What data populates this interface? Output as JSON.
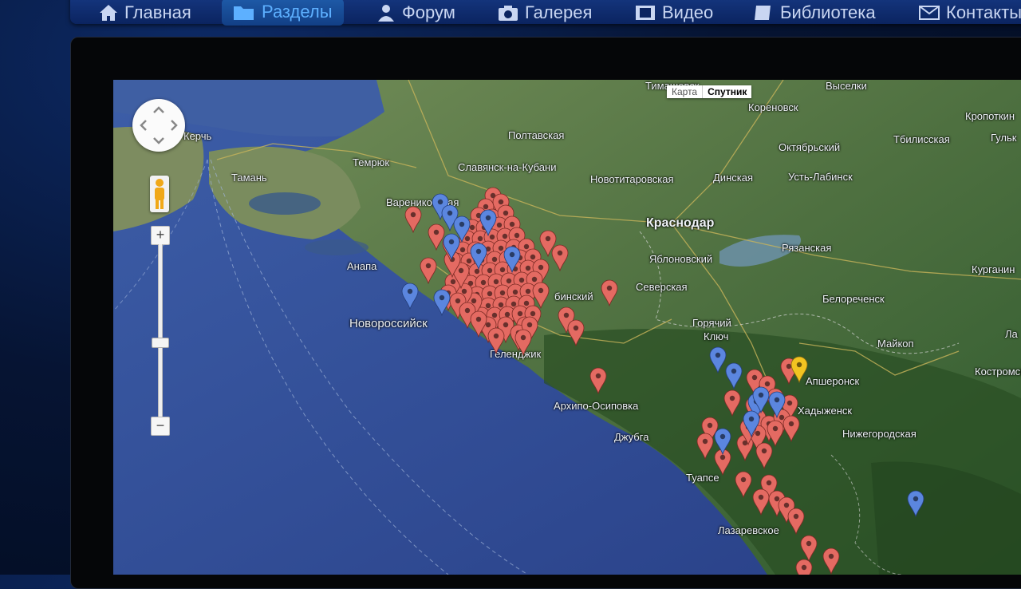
{
  "nav": {
    "items": [
      {
        "label": "Главная",
        "icon": "home-icon"
      },
      {
        "label": "Разделы",
        "icon": "folder-icon",
        "active": true
      },
      {
        "label": "Форум",
        "icon": "user-icon"
      },
      {
        "label": "Галерея",
        "icon": "camera-icon"
      },
      {
        "label": "Видео",
        "icon": "film-icon"
      },
      {
        "label": "Библиотека",
        "icon": "book-icon"
      },
      {
        "label": "Контакты",
        "icon": "mail-icon"
      }
    ]
  },
  "map": {
    "map_type": {
      "map": "Карта",
      "satellite": "Спутник",
      "selected": "satellite"
    },
    "places": {
      "kerch": "Керчь",
      "taman": "Тамань",
      "temryuk": "Темрюк",
      "varenikovskaya": "Варениковская",
      "anapa": "Анапа",
      "novorossiysk": "Новороссийск",
      "slavyansk": "Славянск-на-Кубани",
      "poltavskaya": "Полтавская",
      "novotitarovskaya": "Новотитаровская",
      "timashevsk": "Тимашевск",
      "korenovsk": "Кореновск",
      "vyselki": "Выселки",
      "krasnodar": "Краснодар",
      "dinskaya": "Динская",
      "oktyabrsky": "Октябрьский",
      "ust_labinsk": "Усть-Лабинск",
      "kropotkin": "Кропоткин",
      "tbilisskaya": "Тбилисская",
      "gulkevichi": "Гульк",
      "yablonovsky": "Яблоновский",
      "ryazanskaya": "Рязанская",
      "severskaya": "Северская",
      "abinsk": "бинский",
      "goryachy_klyuch_1": "Горячий",
      "goryachy_klyuch_2": "Ключ",
      "belorechensk": "Белореченск",
      "maykop": "Майкоп",
      "kurganinsk": "Курганин",
      "gelendzhik": "Геленджик",
      "arkhipo": "Архипо-Осиповка",
      "dzhubga": "Джубга",
      "tuapse": "Туапсе",
      "lazarevskoe": "Лазаревское",
      "apsheronsk": "Апшеронск",
      "khadyzhensk": "Хадыженск",
      "nizhegorodskaya": "Нижегородская",
      "kostromskaya": "Костромск",
      "la": "Ла"
    },
    "marker_colors": {
      "red": "#e46a62",
      "blue": "#5b86df",
      "yellow": "#f2c421"
    },
    "marker_counts": {
      "red": 148,
      "blue": 17,
      "yellow": 1
    }
  }
}
